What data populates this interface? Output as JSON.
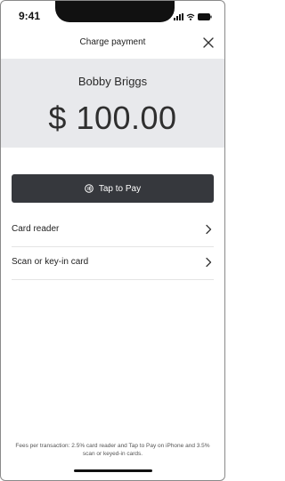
{
  "status_bar": {
    "time": "9:41"
  },
  "header": {
    "title": "Charge payment",
    "close_icon": "close-icon"
  },
  "charge": {
    "customer_name": "Bobby Briggs",
    "amount": "$ 100.00"
  },
  "tap_to_pay": {
    "label": "Tap to Pay",
    "icon": "contactless-icon"
  },
  "options": [
    {
      "label": "Card reader",
      "icon": "chevron-right-icon"
    },
    {
      "label": "Scan or key-in card",
      "icon": "chevron-right-icon"
    }
  ],
  "footer": {
    "fees_note": "Fees per transaction: 2.5% card reader and Tap to Pay on iPhone and 3.5% scan or keyed-in cards."
  },
  "colors": {
    "panel_background": "#e8e9ec",
    "button_background": "#36383d",
    "text_primary": "#222222"
  }
}
